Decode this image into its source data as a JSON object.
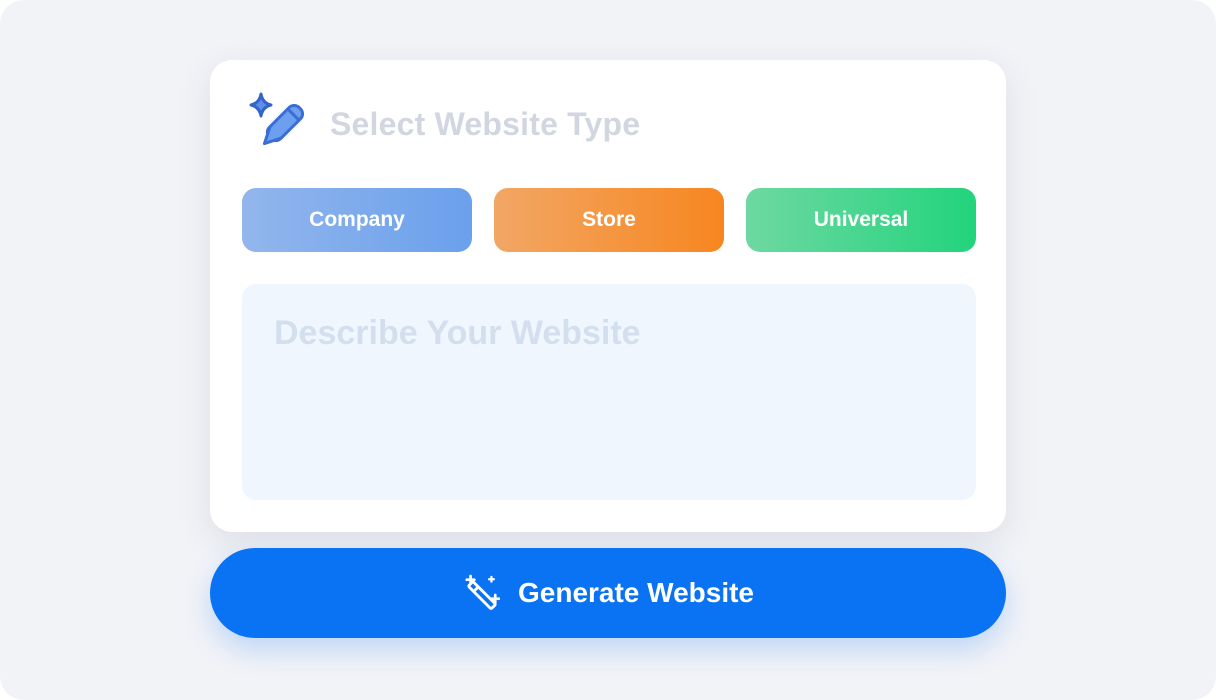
{
  "card": {
    "title": "Select Website Type",
    "header_icon": "sparkle-pencil-icon",
    "types": [
      {
        "label": "Company",
        "color_from": "#93b6ec",
        "color_to": "#6aa0ec"
      },
      {
        "label": "Store",
        "color_from": "#f2a765",
        "color_to": "#f7861f"
      },
      {
        "label": "Universal",
        "color_from": "#6ed8a2",
        "color_to": "#22d47c"
      }
    ],
    "description": {
      "placeholder": "Describe Your Website",
      "value": ""
    }
  },
  "generate": {
    "label": "Generate Website",
    "icon": "magic-wand-icon",
    "color": "#0a73f4"
  }
}
